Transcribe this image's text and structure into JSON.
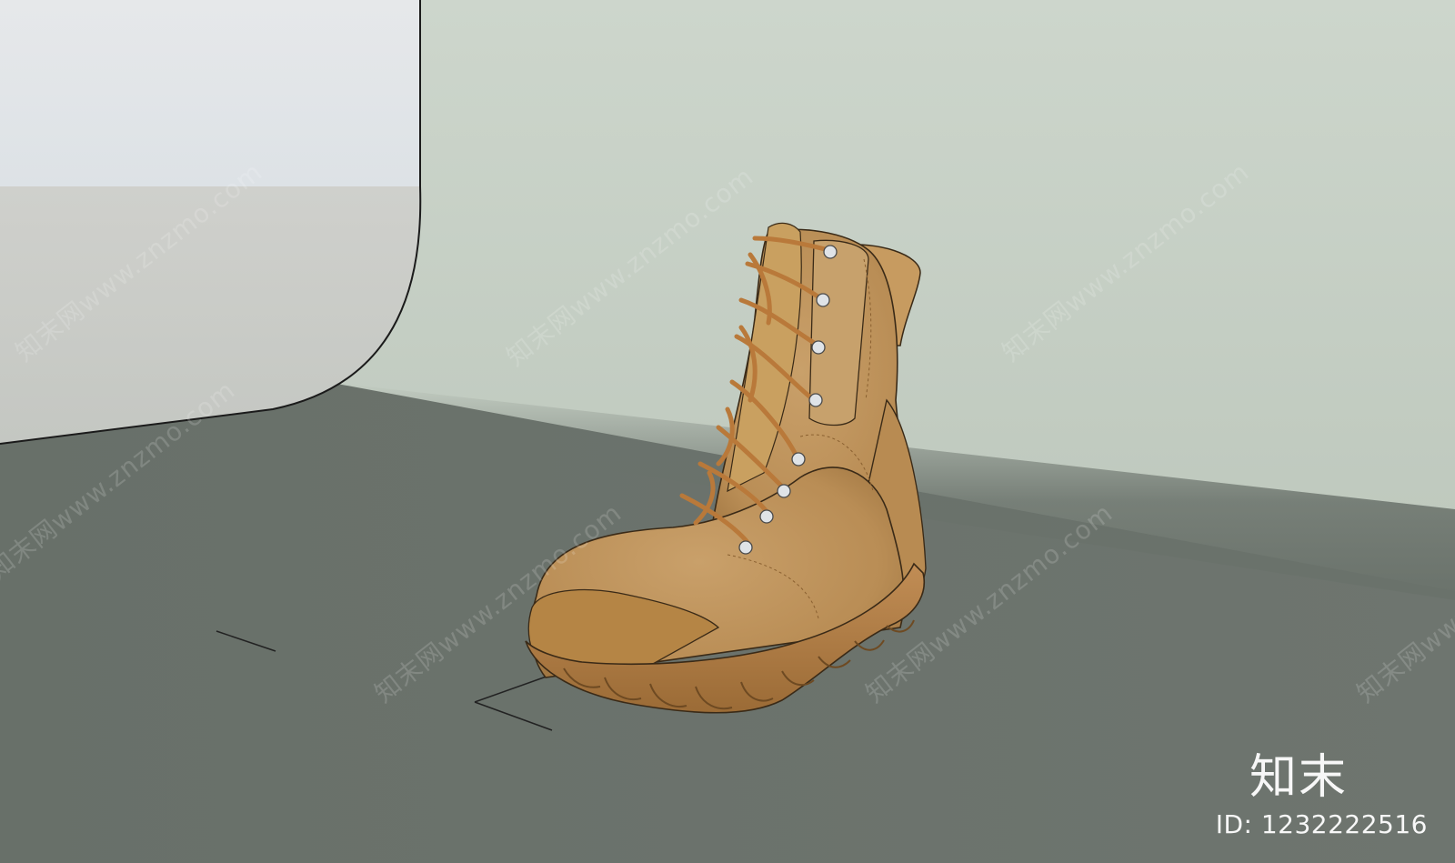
{
  "colors": {
    "wall": "#c9d3c8",
    "floor": "#6a716b",
    "panel": "#ced0cc",
    "panel_top": "#e8ebee",
    "boot_leather": "#c3995c",
    "boot_shadow": "#a6783f",
    "lace": "#c58a45",
    "eyelet": "#d8dde2"
  },
  "watermark": {
    "text": "知末网www.znzmo.com"
  },
  "brand": {
    "logo": "知末",
    "id_label": "ID: 1232222516"
  }
}
